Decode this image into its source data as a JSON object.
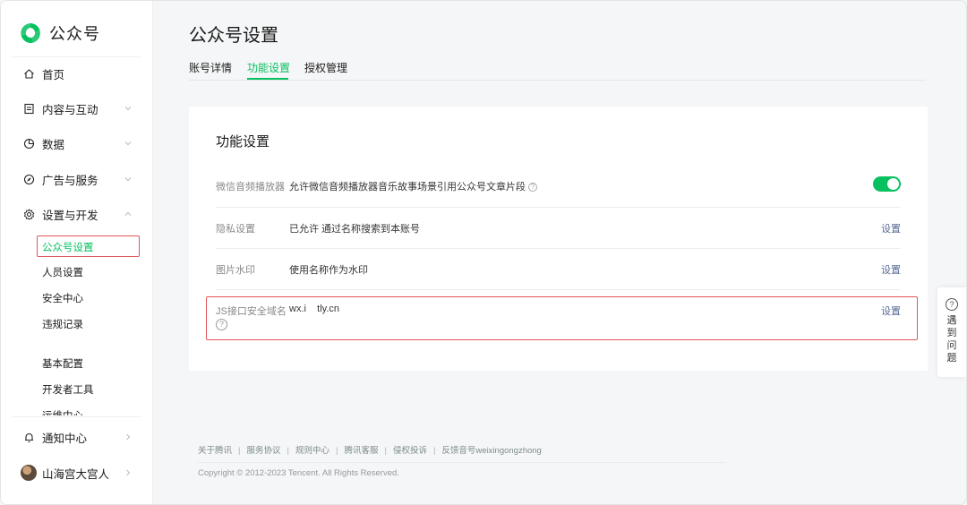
{
  "brand": {
    "name": "公众号",
    "logo_icon": "wechat-official-account-logo",
    "accent": "#07c160"
  },
  "sidebar": {
    "items": [
      {
        "label": "首页",
        "icon": "home-icon"
      },
      {
        "label": "内容与互动",
        "icon": "document-icon"
      },
      {
        "label": "数据",
        "icon": "pie-chart-icon"
      },
      {
        "label": "广告与服务",
        "icon": "compass-icon"
      },
      {
        "label": "设置与开发",
        "icon": "gear-icon"
      }
    ],
    "sub_items": [
      "公众号设置",
      "人员设置",
      "安全中心",
      "违规记录",
      "基本配置",
      "开发者工具",
      "运维中心"
    ],
    "notification": "通知中心",
    "account_name": "山海宫大宫人"
  },
  "page": {
    "title": "公众号设置",
    "tabs": [
      "账号详情",
      "功能设置",
      "授权管理"
    ],
    "active_tab": "功能设置"
  },
  "card": {
    "title": "功能设置",
    "rows": [
      {
        "label": "微信音频播放器",
        "value": "允许微信音频播放器音乐故事场景引用公众号文章片段",
        "action": "",
        "toggle_on": true
      },
      {
        "label": "隐私设置",
        "value": "已允许 通过名称搜索到本账号",
        "action": "设置"
      },
      {
        "label": "图片水印",
        "value": "使用名称作为水印",
        "action": "设置"
      },
      {
        "label": "JS接口安全域名",
        "value": "wx.i    tly.cn",
        "action": "设置"
      }
    ]
  },
  "footer": {
    "links": [
      "关于腾讯",
      "服务协议",
      "规则中心",
      "腾讯客服",
      "侵权投诉",
      "反馈音号weixingongzhong"
    ],
    "copyright": "Copyright © 2012-2023 Tencent. All Rights Reserved."
  },
  "float_help": {
    "label": "遇到问题"
  }
}
